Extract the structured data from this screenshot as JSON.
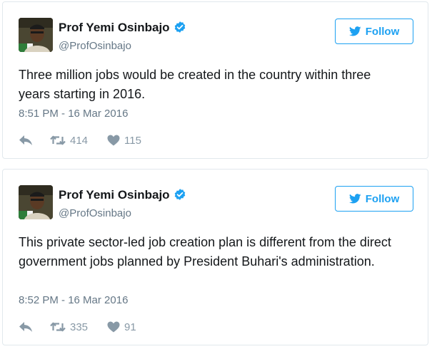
{
  "tweets": [
    {
      "author_name": "Prof Yemi Osinbajo",
      "handle": "@ProfOsinbajo",
      "follow_label": "Follow",
      "text": "Three million jobs would be created in the country within three years starting in 2016.",
      "timestamp": "8:51 PM - 16 Mar 2016",
      "retweets": "414",
      "likes": "115"
    },
    {
      "author_name": "Prof Yemi Osinbajo",
      "handle": "@ProfOsinbajo",
      "follow_label": "Follow",
      "text": "This private sector-led job creation plan is different from the direct government jobs planned by President Buhari's administration.",
      "timestamp": "8:52 PM - 16 Mar 2016",
      "retweets": "335",
      "likes": "91"
    }
  ],
  "colors": {
    "accent": "#1da1f2",
    "text": "#14171a",
    "secondary": "#657786",
    "icon": "#8899a6",
    "border": "#e1e8ed"
  },
  "icons": {
    "verified": "verified-badge-icon",
    "follow": "twitter-bird-icon",
    "reply": "reply-arrow-icon",
    "retweet": "retweet-icon",
    "like": "heart-icon"
  }
}
